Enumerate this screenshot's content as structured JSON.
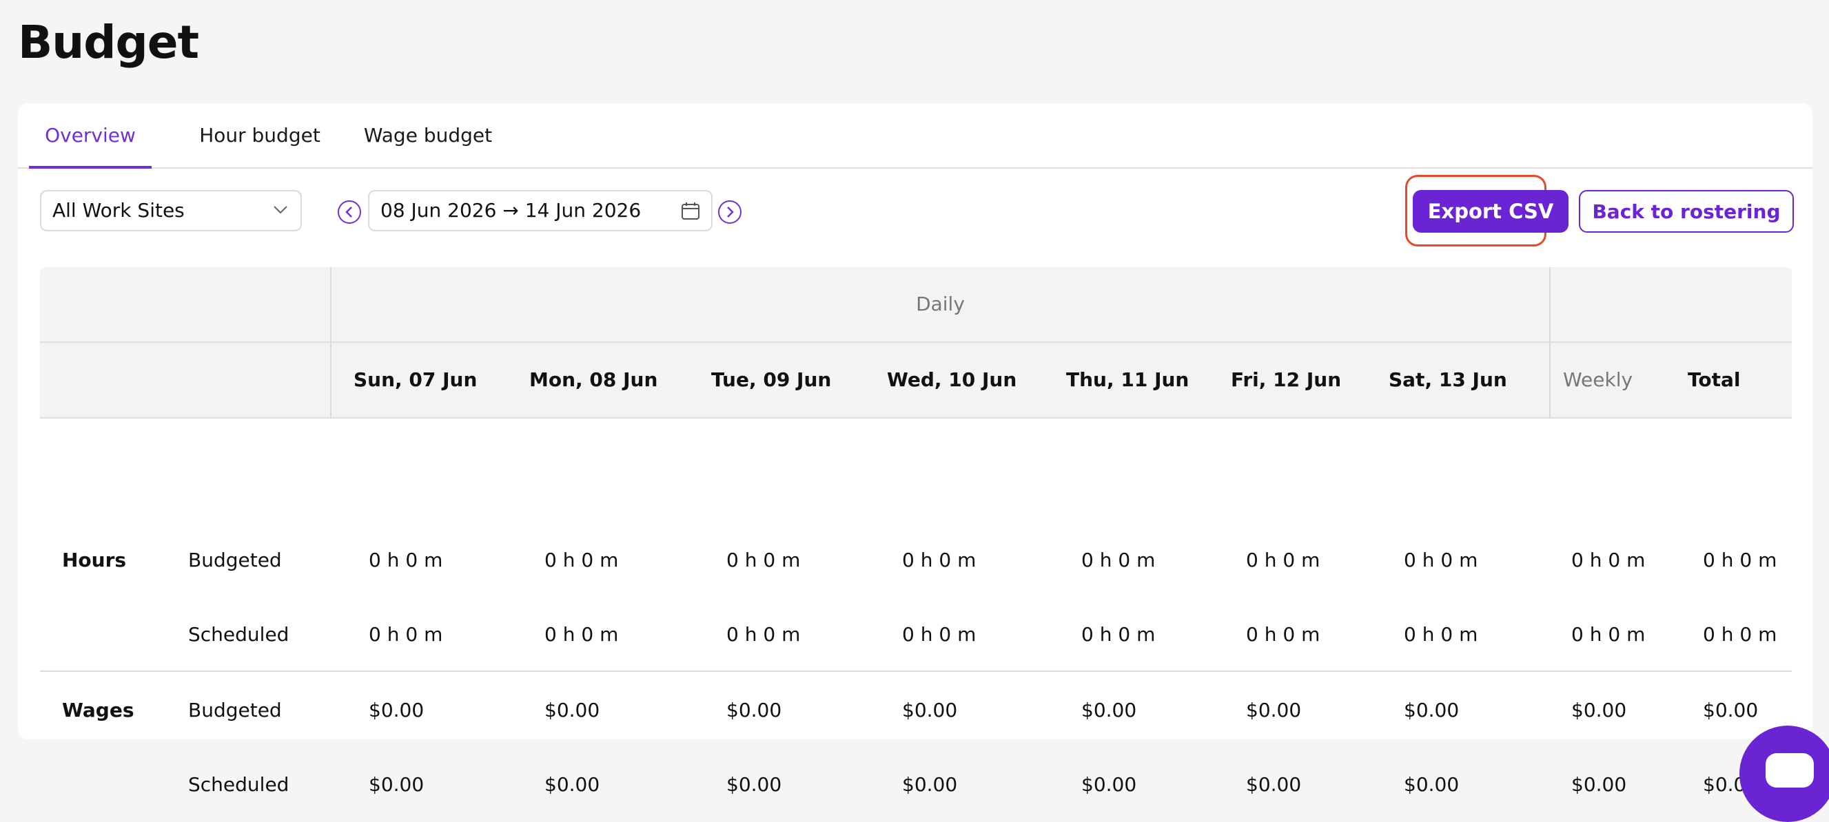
{
  "page": {
    "title": "Budget"
  },
  "tabs": [
    {
      "label": "Overview",
      "active": true
    },
    {
      "label": "Hour budget",
      "active": false
    },
    {
      "label": "Wage budget",
      "active": false
    }
  ],
  "filters": {
    "site_select": "All Work Sites",
    "date_range": "08 Jun 2026 → 14 Jun 2026"
  },
  "actions": {
    "export_label": "Export CSV",
    "back_label": "Back to rostering"
  },
  "table": {
    "group_header": "Daily",
    "columns": [
      "Sun, 07 Jun",
      "Mon, 08 Jun",
      "Tue, 09 Jun",
      "Wed, 10 Jun",
      "Thu, 11 Jun",
      "Fri, 12 Jun",
      "Sat, 13 Jun"
    ],
    "weekly_label": "Weekly",
    "total_label": "Total",
    "groups": [
      {
        "label": "Hours",
        "rows": [
          {
            "label": "Budgeted",
            "values": [
              "0 h 0 m",
              "0 h 0 m",
              "0 h 0 m",
              "0 h 0 m",
              "0 h 0 m",
              "0 h 0 m",
              "0 h 0 m",
              "0 h 0 m",
              "0 h 0 m"
            ]
          },
          {
            "label": "Scheduled",
            "values": [
              "0 h 0 m",
              "0 h 0 m",
              "0 h 0 m",
              "0 h 0 m",
              "0 h 0 m",
              "0 h 0 m",
              "0 h 0 m",
              "0 h 0 m",
              "0 h 0 m"
            ]
          }
        ]
      },
      {
        "label": "Wages",
        "rows": [
          {
            "label": "Budgeted",
            "values": [
              "$0.00",
              "$0.00",
              "$0.00",
              "$0.00",
              "$0.00",
              "$0.00",
              "$0.00",
              "$0.00",
              "$0.00"
            ]
          },
          {
            "label": "Scheduled",
            "values": [
              "$0.00",
              "$0.00",
              "$0.00",
              "$0.00",
              "$0.00",
              "$0.00",
              "$0.00",
              "$0.00",
              "$0.00"
            ]
          }
        ]
      }
    ]
  },
  "colors": {
    "accent": "#6a24d4",
    "highlight": "#e24a2c"
  },
  "icons": [
    "chevron-down-icon",
    "prev-arrow-icon",
    "next-arrow-icon",
    "calendar-icon",
    "chat-icon"
  ]
}
